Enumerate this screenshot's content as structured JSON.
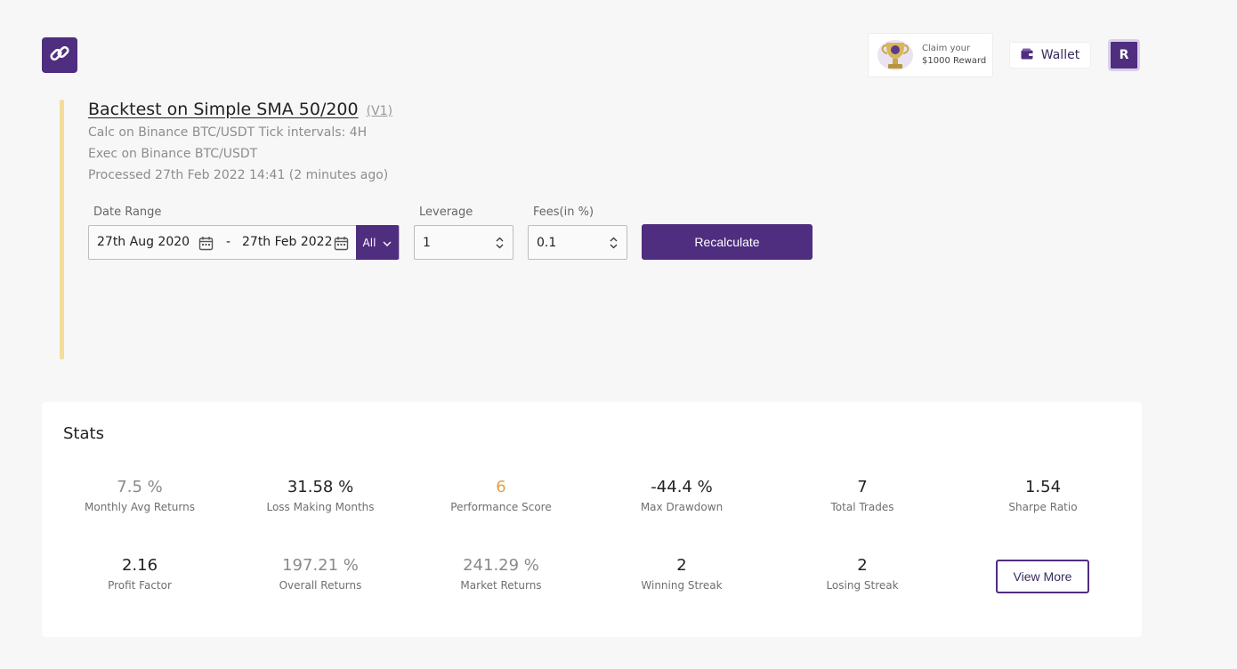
{
  "header": {
    "logo_icon": "chain-link-icon",
    "reward": {
      "line1": "Claim your",
      "line2": "$1000 Reward",
      "icon": "trophy-icon"
    },
    "wallet_label": "Wallet",
    "avatar_initial": "R"
  },
  "backtest": {
    "title": "Backtest on Simple SMA 50/200",
    "version": "(V1)",
    "calc_line": "Calc on Binance BTC/USDT Tick intervals: 4H",
    "exec_line": "Exec on Binance BTC/USDT",
    "processed_line": "Processed 27th Feb 2022 14:41 (2 minutes ago)"
  },
  "form": {
    "date_range_label": "Date Range",
    "start_date": "27th Aug 2020",
    "separator": "-",
    "end_date": "27th Feb 2022",
    "range_select": "All",
    "leverage_label": "Leverage",
    "leverage_value": "1",
    "fees_label": "Fees(in %)",
    "fees_value": "0.1",
    "recalculate_label": "Recalculate"
  },
  "stats": {
    "title": "Stats",
    "items": [
      {
        "value": "7.5 %",
        "label": "Monthly Avg Returns",
        "tone": "muted"
      },
      {
        "value": "31.58 %",
        "label": "Loss Making Months",
        "tone": "normal"
      },
      {
        "value": "6",
        "label": "Performance Score",
        "tone": "accent"
      },
      {
        "value": "-44.4 %",
        "label": "Max Drawdown",
        "tone": "normal"
      },
      {
        "value": "7",
        "label": "Total Trades",
        "tone": "normal"
      },
      {
        "value": "1.54",
        "label": "Sharpe Ratio",
        "tone": "normal"
      },
      {
        "value": "2.16",
        "label": "Profit Factor",
        "tone": "normal"
      },
      {
        "value": "197.21 %",
        "label": "Overall Returns",
        "tone": "muted"
      },
      {
        "value": "241.29 %",
        "label": "Market Returns",
        "tone": "muted"
      },
      {
        "value": "2",
        "label": "Winning Streak",
        "tone": "normal"
      },
      {
        "value": "2",
        "label": "Losing Streak",
        "tone": "normal"
      }
    ],
    "view_more_label": "View More"
  },
  "colors": {
    "brand": "#4f2d7f",
    "accent_bar": "#f4dc9a",
    "score_accent": "#e2a24a",
    "background": "#f7f7f7"
  }
}
